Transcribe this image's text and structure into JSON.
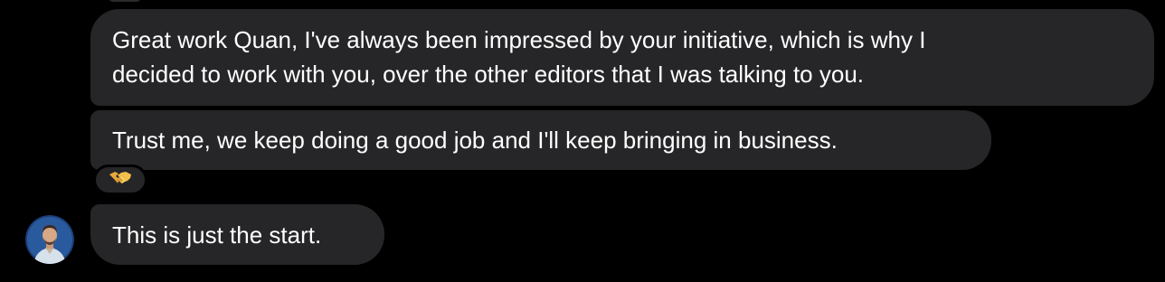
{
  "conversation": {
    "messages": [
      {
        "lines": [
          "Great work Quan, I've always been impressed by your initiative, which is why I",
          "decided to work with you, over the other editors that I was talking to you."
        ]
      },
      {
        "text": "Trust me, we keep doing a good job and I'll keep bringing in business.",
        "reaction": {
          "icon": "handshake-icon"
        }
      },
      {
        "text": "This is just the start.",
        "sender_avatar": "avatar"
      }
    ]
  },
  "colors": {
    "background": "#000000",
    "bubble": "#262628",
    "text": "#ffffff",
    "reaction_emoji": "#f2b63c"
  }
}
